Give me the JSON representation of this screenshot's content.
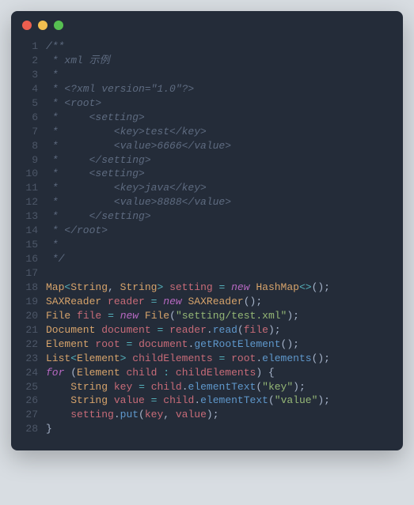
{
  "window": {
    "dots": {
      "red": "#ec5e4f",
      "yellow": "#f1be4f",
      "green": "#56bf51"
    }
  },
  "lines": [
    {
      "n": "1",
      "tokens": [
        {
          "c": "tok-comment",
          "t": "/**"
        }
      ]
    },
    {
      "n": "2",
      "tokens": [
        {
          "c": "tok-comment",
          "t": " * xml 示例"
        }
      ]
    },
    {
      "n": "3",
      "tokens": [
        {
          "c": "tok-comment",
          "t": " *"
        }
      ]
    },
    {
      "n": "4",
      "tokens": [
        {
          "c": "tok-comment",
          "t": " * <?xml version=\"1.0\"?>"
        }
      ]
    },
    {
      "n": "5",
      "tokens": [
        {
          "c": "tok-comment",
          "t": " * <root>"
        }
      ]
    },
    {
      "n": "6",
      "tokens": [
        {
          "c": "tok-comment",
          "t": " *     <setting>"
        }
      ]
    },
    {
      "n": "7",
      "tokens": [
        {
          "c": "tok-comment",
          "t": " *         <key>test</key>"
        }
      ]
    },
    {
      "n": "8",
      "tokens": [
        {
          "c": "tok-comment",
          "t": " *         <value>6666</value>"
        }
      ]
    },
    {
      "n": "9",
      "tokens": [
        {
          "c": "tok-comment",
          "t": " *     </setting>"
        }
      ]
    },
    {
      "n": "10",
      "tokens": [
        {
          "c": "tok-comment",
          "t": " *     <setting>"
        }
      ]
    },
    {
      "n": "11",
      "tokens": [
        {
          "c": "tok-comment",
          "t": " *         <key>java</key>"
        }
      ]
    },
    {
      "n": "12",
      "tokens": [
        {
          "c": "tok-comment",
          "t": " *         <value>8888</value>"
        }
      ]
    },
    {
      "n": "13",
      "tokens": [
        {
          "c": "tok-comment",
          "t": " *     </setting>"
        }
      ]
    },
    {
      "n": "14",
      "tokens": [
        {
          "c": "tok-comment",
          "t": " * </root>"
        }
      ]
    },
    {
      "n": "15",
      "tokens": [
        {
          "c": "tok-comment",
          "t": " *"
        }
      ]
    },
    {
      "n": "16",
      "tokens": [
        {
          "c": "tok-comment",
          "t": " */"
        }
      ]
    },
    {
      "n": "17",
      "tokens": []
    },
    {
      "n": "18",
      "tokens": [
        {
          "c": "tok-type",
          "t": "Map"
        },
        {
          "c": "tok-op",
          "t": "<"
        },
        {
          "c": "tok-type",
          "t": "String"
        },
        {
          "c": "tok-punct",
          "t": ", "
        },
        {
          "c": "tok-type",
          "t": "String"
        },
        {
          "c": "tok-op",
          "t": ">"
        },
        {
          "c": "tok-punct",
          "t": " "
        },
        {
          "c": "tok-ident",
          "t": "setting"
        },
        {
          "c": "tok-punct",
          "t": " "
        },
        {
          "c": "tok-op",
          "t": "="
        },
        {
          "c": "tok-punct",
          "t": " "
        },
        {
          "c": "tok-keyword",
          "t": "new"
        },
        {
          "c": "tok-punct",
          "t": " "
        },
        {
          "c": "tok-type",
          "t": "HashMap"
        },
        {
          "c": "tok-op",
          "t": "<>"
        },
        {
          "c": "tok-punct",
          "t": "();"
        }
      ]
    },
    {
      "n": "19",
      "tokens": [
        {
          "c": "tok-type",
          "t": "SAXReader"
        },
        {
          "c": "tok-punct",
          "t": " "
        },
        {
          "c": "tok-ident",
          "t": "reader"
        },
        {
          "c": "tok-punct",
          "t": " "
        },
        {
          "c": "tok-op",
          "t": "="
        },
        {
          "c": "tok-punct",
          "t": " "
        },
        {
          "c": "tok-keyword",
          "t": "new"
        },
        {
          "c": "tok-punct",
          "t": " "
        },
        {
          "c": "tok-type",
          "t": "SAXReader"
        },
        {
          "c": "tok-punct",
          "t": "();"
        }
      ]
    },
    {
      "n": "20",
      "tokens": [
        {
          "c": "tok-type",
          "t": "File"
        },
        {
          "c": "tok-punct",
          "t": " "
        },
        {
          "c": "tok-ident",
          "t": "file"
        },
        {
          "c": "tok-punct",
          "t": " "
        },
        {
          "c": "tok-op",
          "t": "="
        },
        {
          "c": "tok-punct",
          "t": " "
        },
        {
          "c": "tok-keyword",
          "t": "new"
        },
        {
          "c": "tok-punct",
          "t": " "
        },
        {
          "c": "tok-type",
          "t": "File"
        },
        {
          "c": "tok-punct",
          "t": "("
        },
        {
          "c": "tok-string",
          "t": "\"setting/test.xml\""
        },
        {
          "c": "tok-punct",
          "t": ");"
        }
      ]
    },
    {
      "n": "21",
      "tokens": [
        {
          "c": "tok-type",
          "t": "Document"
        },
        {
          "c": "tok-punct",
          "t": " "
        },
        {
          "c": "tok-ident",
          "t": "document"
        },
        {
          "c": "tok-punct",
          "t": " "
        },
        {
          "c": "tok-op",
          "t": "="
        },
        {
          "c": "tok-punct",
          "t": " "
        },
        {
          "c": "tok-ident",
          "t": "reader"
        },
        {
          "c": "tok-punct",
          "t": "."
        },
        {
          "c": "tok-method",
          "t": "read"
        },
        {
          "c": "tok-punct",
          "t": "("
        },
        {
          "c": "tok-ident",
          "t": "file"
        },
        {
          "c": "tok-punct",
          "t": ");"
        }
      ]
    },
    {
      "n": "22",
      "tokens": [
        {
          "c": "tok-type",
          "t": "Element"
        },
        {
          "c": "tok-punct",
          "t": " "
        },
        {
          "c": "tok-ident",
          "t": "root"
        },
        {
          "c": "tok-punct",
          "t": " "
        },
        {
          "c": "tok-op",
          "t": "="
        },
        {
          "c": "tok-punct",
          "t": " "
        },
        {
          "c": "tok-ident",
          "t": "document"
        },
        {
          "c": "tok-punct",
          "t": "."
        },
        {
          "c": "tok-method",
          "t": "getRootElement"
        },
        {
          "c": "tok-punct",
          "t": "();"
        }
      ]
    },
    {
      "n": "23",
      "tokens": [
        {
          "c": "tok-type",
          "t": "List"
        },
        {
          "c": "tok-op",
          "t": "<"
        },
        {
          "c": "tok-type",
          "t": "Element"
        },
        {
          "c": "tok-op",
          "t": ">"
        },
        {
          "c": "tok-punct",
          "t": " "
        },
        {
          "c": "tok-ident",
          "t": "childElements"
        },
        {
          "c": "tok-punct",
          "t": " "
        },
        {
          "c": "tok-op",
          "t": "="
        },
        {
          "c": "tok-punct",
          "t": " "
        },
        {
          "c": "tok-ident",
          "t": "root"
        },
        {
          "c": "tok-punct",
          "t": "."
        },
        {
          "c": "tok-method",
          "t": "elements"
        },
        {
          "c": "tok-punct",
          "t": "();"
        }
      ]
    },
    {
      "n": "24",
      "tokens": [
        {
          "c": "tok-keyword",
          "t": "for"
        },
        {
          "c": "tok-punct",
          "t": " ("
        },
        {
          "c": "tok-type",
          "t": "Element"
        },
        {
          "c": "tok-punct",
          "t": " "
        },
        {
          "c": "tok-ident",
          "t": "child"
        },
        {
          "c": "tok-punct",
          "t": " "
        },
        {
          "c": "tok-op",
          "t": ":"
        },
        {
          "c": "tok-punct",
          "t": " "
        },
        {
          "c": "tok-ident",
          "t": "childElements"
        },
        {
          "c": "tok-punct",
          "t": ") {"
        }
      ]
    },
    {
      "n": "25",
      "tokens": [
        {
          "c": "tok-punct",
          "t": "    "
        },
        {
          "c": "tok-type",
          "t": "String"
        },
        {
          "c": "tok-punct",
          "t": " "
        },
        {
          "c": "tok-ident",
          "t": "key"
        },
        {
          "c": "tok-punct",
          "t": " "
        },
        {
          "c": "tok-op",
          "t": "="
        },
        {
          "c": "tok-punct",
          "t": " "
        },
        {
          "c": "tok-ident",
          "t": "child"
        },
        {
          "c": "tok-punct",
          "t": "."
        },
        {
          "c": "tok-method",
          "t": "elementText"
        },
        {
          "c": "tok-punct",
          "t": "("
        },
        {
          "c": "tok-string",
          "t": "\"key\""
        },
        {
          "c": "tok-punct",
          "t": ");"
        }
      ]
    },
    {
      "n": "26",
      "tokens": [
        {
          "c": "tok-punct",
          "t": "    "
        },
        {
          "c": "tok-type",
          "t": "String"
        },
        {
          "c": "tok-punct",
          "t": " "
        },
        {
          "c": "tok-ident",
          "t": "value"
        },
        {
          "c": "tok-punct",
          "t": " "
        },
        {
          "c": "tok-op",
          "t": "="
        },
        {
          "c": "tok-punct",
          "t": " "
        },
        {
          "c": "tok-ident",
          "t": "child"
        },
        {
          "c": "tok-punct",
          "t": "."
        },
        {
          "c": "tok-method",
          "t": "elementText"
        },
        {
          "c": "tok-punct",
          "t": "("
        },
        {
          "c": "tok-string",
          "t": "\"value\""
        },
        {
          "c": "tok-punct",
          "t": ");"
        }
      ]
    },
    {
      "n": "27",
      "tokens": [
        {
          "c": "tok-punct",
          "t": "    "
        },
        {
          "c": "tok-ident",
          "t": "setting"
        },
        {
          "c": "tok-punct",
          "t": "."
        },
        {
          "c": "tok-method",
          "t": "put"
        },
        {
          "c": "tok-punct",
          "t": "("
        },
        {
          "c": "tok-ident",
          "t": "key"
        },
        {
          "c": "tok-punct",
          "t": ", "
        },
        {
          "c": "tok-ident",
          "t": "value"
        },
        {
          "c": "tok-punct",
          "t": ");"
        }
      ]
    },
    {
      "n": "28",
      "tokens": [
        {
          "c": "tok-punct",
          "t": "}"
        }
      ]
    }
  ]
}
